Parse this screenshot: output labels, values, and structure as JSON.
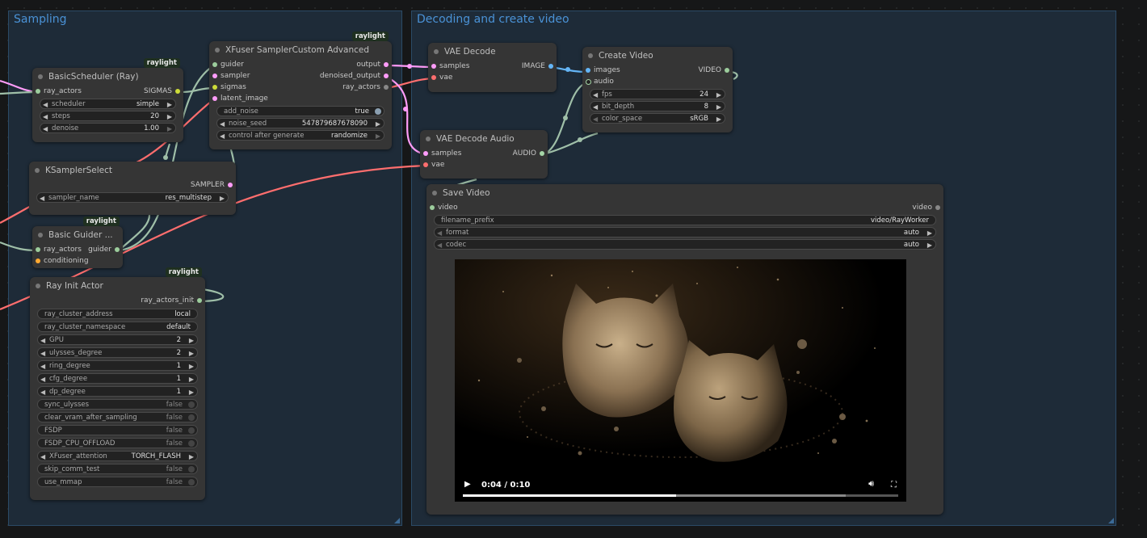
{
  "groups": {
    "sampling": "Sampling",
    "decoding": "Decoding and create video"
  },
  "badge": "raylight",
  "scheduler": {
    "title": "BasicScheduler (Ray)",
    "in_ray_actors": "ray_actors",
    "out_sigmas": "SIGMAS",
    "widgets": [
      {
        "label": "scheduler",
        "value": "simple"
      },
      {
        "label": "steps",
        "value": "20"
      },
      {
        "label": "denoise",
        "value": "1.00"
      }
    ]
  },
  "sampler_custom": {
    "title": "XFuser SamplerCustom Advanced",
    "inputs": [
      "guider",
      "sampler",
      "sigmas",
      "latent_image"
    ],
    "outputs": [
      "output",
      "denoised_output",
      "ray_actors"
    ],
    "add_noise_label": "add_noise",
    "add_noise_value": "true",
    "noise_seed_label": "noise_seed",
    "noise_seed_value": "547879687678090",
    "control_label": "control after generate",
    "control_value": "randomize"
  },
  "ksampler_select": {
    "title": "KSamplerSelect",
    "out": "SAMPLER",
    "widget_label": "sampler_name",
    "widget_value": "res_multistep"
  },
  "guider": {
    "title": "Basic Guider ...",
    "in_ray_actors": "ray_actors",
    "in_conditioning": "conditioning",
    "out_guider": "guider"
  },
  "init_actor": {
    "title": "Ray Init Actor",
    "out": "ray_actors_init",
    "widgets": [
      {
        "label": "ray_cluster_address",
        "value": "local",
        "kind": "text"
      },
      {
        "label": "ray_cluster_namespace",
        "value": "default",
        "kind": "text"
      },
      {
        "label": "GPU",
        "value": "2",
        "kind": "num"
      },
      {
        "label": "ulysses_degree",
        "value": "2",
        "kind": "num"
      },
      {
        "label": "ring_degree",
        "value": "1",
        "kind": "num"
      },
      {
        "label": "cfg_degree",
        "value": "1",
        "kind": "num"
      },
      {
        "label": "dp_degree",
        "value": "1",
        "kind": "num"
      },
      {
        "label": "sync_ulysses",
        "value": "false",
        "kind": "tog"
      },
      {
        "label": "clear_vram_after_sampling",
        "value": "false",
        "kind": "tog"
      },
      {
        "label": "FSDP",
        "value": "false",
        "kind": "tog"
      },
      {
        "label": "FSDP_CPU_OFFLOAD",
        "value": "false",
        "kind": "tog"
      },
      {
        "label": "XFuser_attention",
        "value": "TORCH_FLASH",
        "kind": "num"
      },
      {
        "label": "skip_comm_test",
        "value": "false",
        "kind": "tog"
      },
      {
        "label": "use_mmap",
        "value": "false",
        "kind": "tog"
      }
    ]
  },
  "vae_decode": {
    "title": "VAE Decode",
    "in_samples": "samples",
    "in_vae": "vae",
    "out": "IMAGE"
  },
  "vae_audio": {
    "title": "VAE Decode Audio",
    "in_samples": "samples",
    "in_vae": "vae",
    "out": "AUDIO"
  },
  "create_video": {
    "title": "Create Video",
    "in_images": "images",
    "in_audio": "audio",
    "out": "VIDEO",
    "widgets": [
      {
        "label": "fps",
        "value": "24"
      },
      {
        "label": "bit_depth",
        "value": "8"
      },
      {
        "label": "color_space",
        "value": "sRGB"
      }
    ]
  },
  "save_video": {
    "title": "Save Video",
    "in_video": "video",
    "out_video": "video",
    "filename_label": "filename_prefix",
    "filename_value": "video/RayWorker",
    "format_label": "format",
    "format_value": "auto",
    "codec_label": "codec",
    "codec_value": "auto",
    "time": "0:04 / 0:10",
    "progress": 0.49,
    "buffered": 0.88
  },
  "colors": {
    "latent": "#ff9cf9",
    "vae": "#ff6e6e",
    "image": "#64b5f6",
    "audio": "#a5d6a7",
    "sigmas": "#cddc39",
    "generic": "#9ccc9c",
    "conditioning": "#ffa931",
    "group_title": "#4a92d6"
  }
}
